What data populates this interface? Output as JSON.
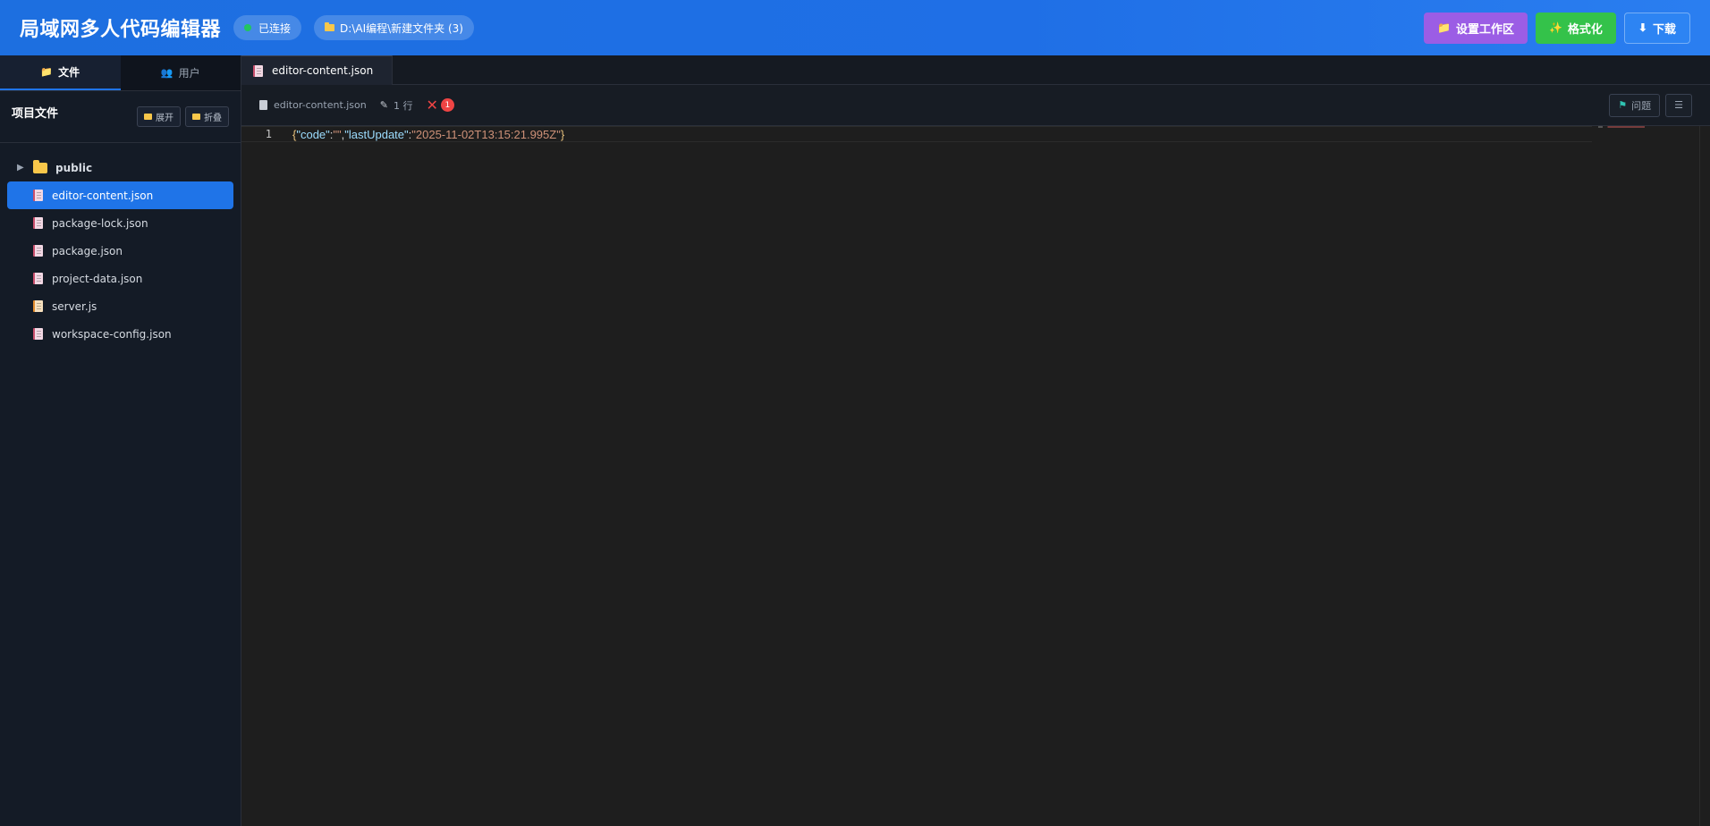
{
  "header": {
    "title": "局域网多人代码编辑器",
    "status": "已连接",
    "path": "D:\\AI编程\\新建文件夹 (3)",
    "buttons": {
      "workspace": "设置工作区",
      "format": "格式化",
      "download": "下载"
    }
  },
  "sidebar": {
    "tabs": {
      "files": "文件",
      "users": "用户"
    },
    "title": "项目文件",
    "expand": "展开",
    "collapse": "折叠",
    "tree": {
      "folder": "public",
      "files": [
        "editor-content.json",
        "package-lock.json",
        "package.json",
        "project-data.json",
        "server.js",
        "workspace-config.json"
      ]
    }
  },
  "editor": {
    "tab": "editor-content.json",
    "toolbar": {
      "filename": "editor-content.json",
      "lines": "1 行",
      "errors": "1",
      "problems": "问题",
      "menu": "☰"
    },
    "code": {
      "line_number": "1",
      "tokens": [
        "{",
        "\"code\"",
        ":",
        "\"\"",
        ",",
        "\"lastUpdate\"",
        ":",
        "\"2025-11-02T13:15:21.995Z\"",
        "}"
      ]
    }
  },
  "colors": {
    "header": "#1f6fe6",
    "accent": "#1f74e8",
    "workspace_button": "#9b5de5",
    "format_button": "#34c24a",
    "error": "#ef4444"
  }
}
